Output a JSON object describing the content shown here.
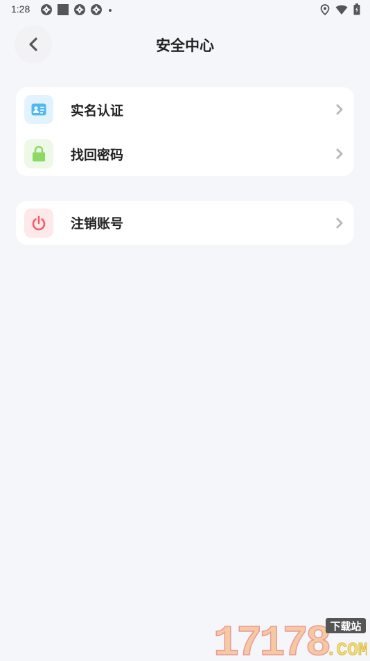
{
  "status_bar": {
    "time": "1:28"
  },
  "header": {
    "title": "安全中心",
    "back_icon": "chevron-left-icon"
  },
  "sections": [
    {
      "items": [
        {
          "label": "实名认证",
          "icon": "id-card-icon",
          "icon_color": "#4fb8f5",
          "icon_bg": "#e3f3fd"
        },
        {
          "label": "找回密码",
          "icon": "lock-icon",
          "icon_color": "#8cd964",
          "icon_bg": "#edf9e6"
        }
      ]
    },
    {
      "items": [
        {
          "label": "注销账号",
          "icon": "power-icon",
          "icon_color": "#f25b6a",
          "icon_bg": "#fde8ea"
        }
      ]
    }
  ],
  "watermark": {
    "number": "17178",
    "tag": "下载站",
    "domain": ".COM"
  },
  "colors": {
    "background": "#f5f6fa",
    "card": "#ffffff",
    "chevron": "#b8b8bd"
  }
}
